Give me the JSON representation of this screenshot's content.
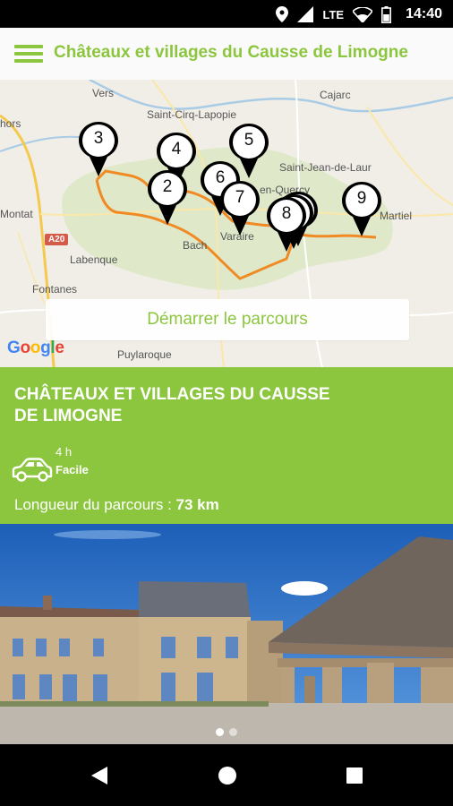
{
  "status_bar": {
    "network": "LTE",
    "time": "14:40",
    "icons": [
      "location-icon",
      "signal-icon",
      "wifi-icon",
      "battery-icon"
    ]
  },
  "app_bar": {
    "title": "Châteaux et villages du Causse de Limogne",
    "menu_icon": "hamburger-menu-icon"
  },
  "map": {
    "place_labels": [
      "Vers",
      "Cajarc",
      "Saint-Cirq-Lapopie",
      "Saint-Jean-de-Laur",
      "hors",
      "Montat",
      "Labenque",
      "Fontanes",
      "Bach",
      "Varaire",
      "Martiel",
      "Puylaroque",
      "en-Quercy"
    ],
    "road_label": "A20",
    "map_provider": "Google",
    "waypoints": [
      "3",
      "4",
      "5",
      "2",
      "6",
      "7",
      "8",
      "9"
    ],
    "route_color": "#f08a24",
    "start_button_label": "Démarrer le parcours"
  },
  "route": {
    "title_line1": "CHÂTEAUX ET VILLAGES DU CAUSSE",
    "title_line2": "DE LIMOGNE",
    "transport_icon": "car-icon",
    "duration": "4 h",
    "difficulty": "Facile",
    "length_label": "Longueur du parcours :",
    "length_value": "73 km"
  },
  "gallery": {
    "image_description": "village-market-hall-photo",
    "page_count": 2,
    "active_index": 0
  },
  "colors": {
    "accent": "#8cc63f",
    "route": "#f08a24"
  },
  "nav_bar": {
    "buttons": [
      "back-icon",
      "home-icon",
      "recents-icon"
    ]
  }
}
